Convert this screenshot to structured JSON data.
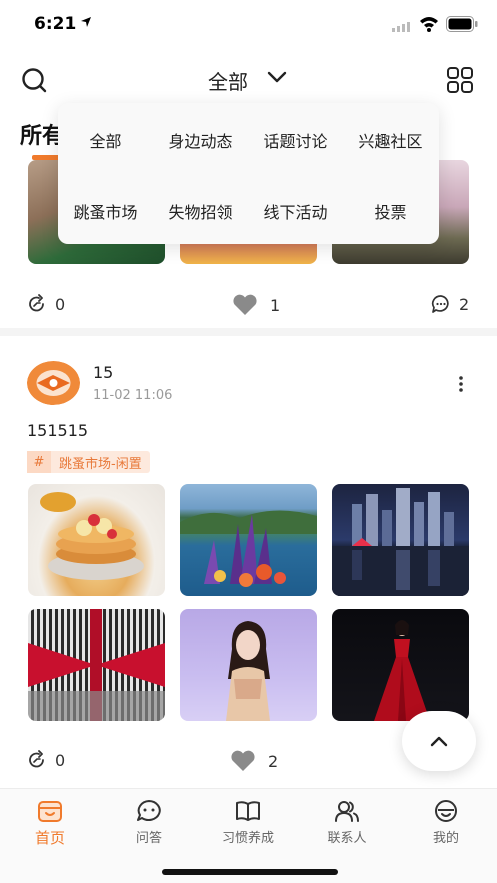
{
  "status_bar": {
    "time": "6:21"
  },
  "nav": {
    "title": "全部"
  },
  "section": {
    "title": "所有"
  },
  "dropdown": {
    "options": [
      "全部",
      "身边动态",
      "话题讨论",
      "兴趣社区",
      "跳蚤市场",
      "失物招领",
      "线下活动",
      "投票"
    ]
  },
  "posts": [
    {
      "shares": "0",
      "likes": "1",
      "comments": "2"
    },
    {
      "username": "15",
      "time": "11-02 11:06",
      "content": "151515",
      "tag": "跳蚤市场-闲置",
      "shares": "0",
      "likes": "2",
      "comments": ""
    }
  ],
  "tabs": [
    {
      "label": "首页",
      "icon": "home-icon",
      "active": true
    },
    {
      "label": "问答",
      "icon": "chat-bubble-icon",
      "active": false
    },
    {
      "label": "习惯养成",
      "icon": "book-icon",
      "active": false
    },
    {
      "label": "联系人",
      "icon": "contacts-icon",
      "active": false
    },
    {
      "label": "我的",
      "icon": "profile-icon",
      "active": false
    }
  ],
  "colors": {
    "accent": "#f07a2c",
    "tag_bg": "#fde9dd"
  }
}
